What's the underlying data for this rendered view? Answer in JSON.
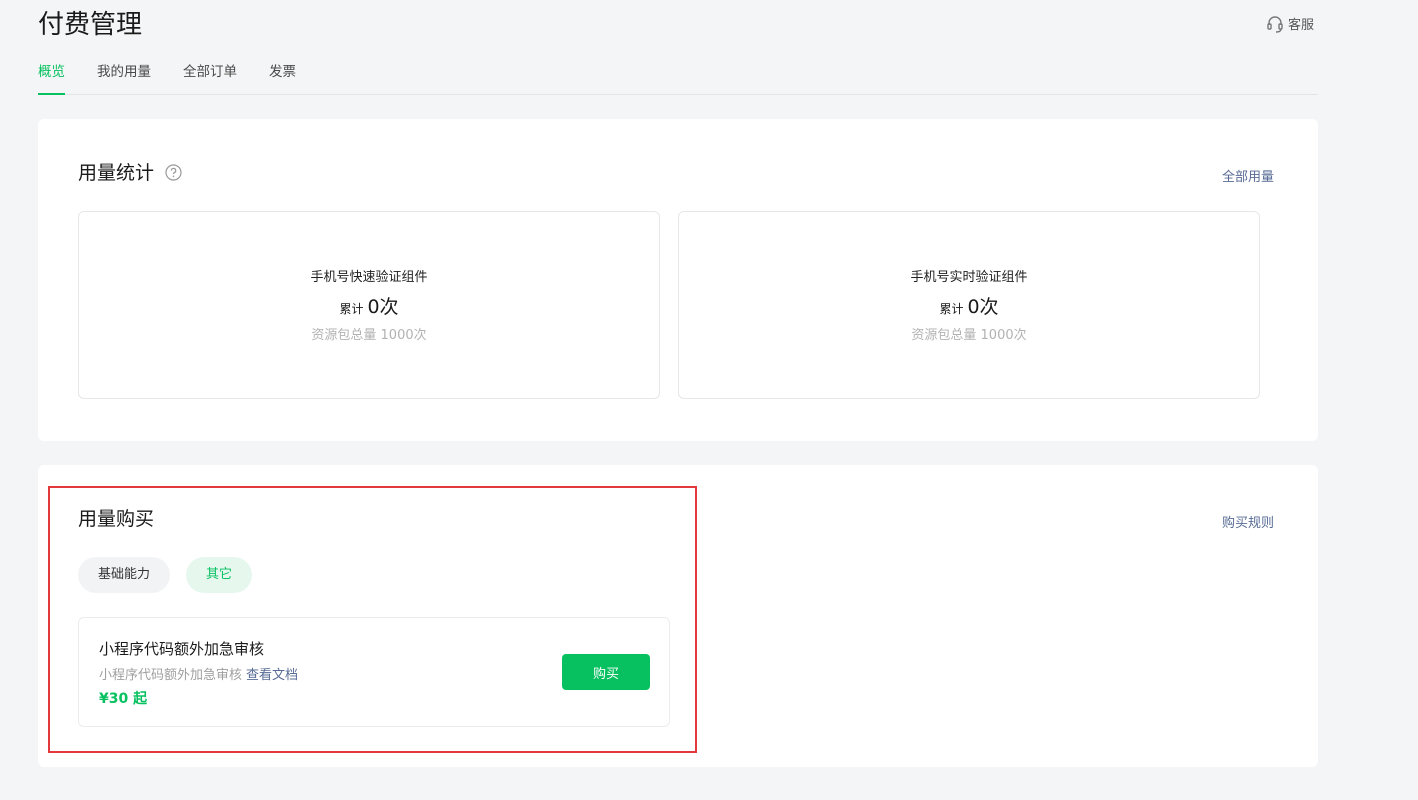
{
  "page": {
    "title": "付费管理",
    "support_label": "客服"
  },
  "tabs": [
    {
      "label": "概览",
      "active": true
    },
    {
      "label": "我的用量",
      "active": false
    },
    {
      "label": "全部订单",
      "active": false
    },
    {
      "label": "发票",
      "active": false
    }
  ],
  "usage": {
    "title": "用量统计",
    "link_label": "全部用量",
    "items": [
      {
        "name": "手机号快速验证组件",
        "count_prefix": "累计",
        "count": "0次",
        "total": "资源包总量 1000次"
      },
      {
        "name": "手机号实时验证组件",
        "count_prefix": "累计",
        "count": "0次",
        "total": "资源包总量 1000次"
      }
    ]
  },
  "purchase": {
    "title": "用量购买",
    "link_label": "购买规则",
    "filters": [
      {
        "label": "基础能力",
        "active": false
      },
      {
        "label": "其它",
        "active": true
      }
    ],
    "product": {
      "name": "小程序代码额外加急审核",
      "description": "小程序代码额外加急审核",
      "doc_link": "查看文档",
      "price": "¥30 起",
      "buy_label": "购买"
    }
  },
  "colors": {
    "accent": "#07c160",
    "link": "#576b95",
    "highlight_border": "#e4393c",
    "background": "#f4f5f7"
  },
  "icons": {
    "support": "headset-icon",
    "help": "question-circle-icon"
  }
}
